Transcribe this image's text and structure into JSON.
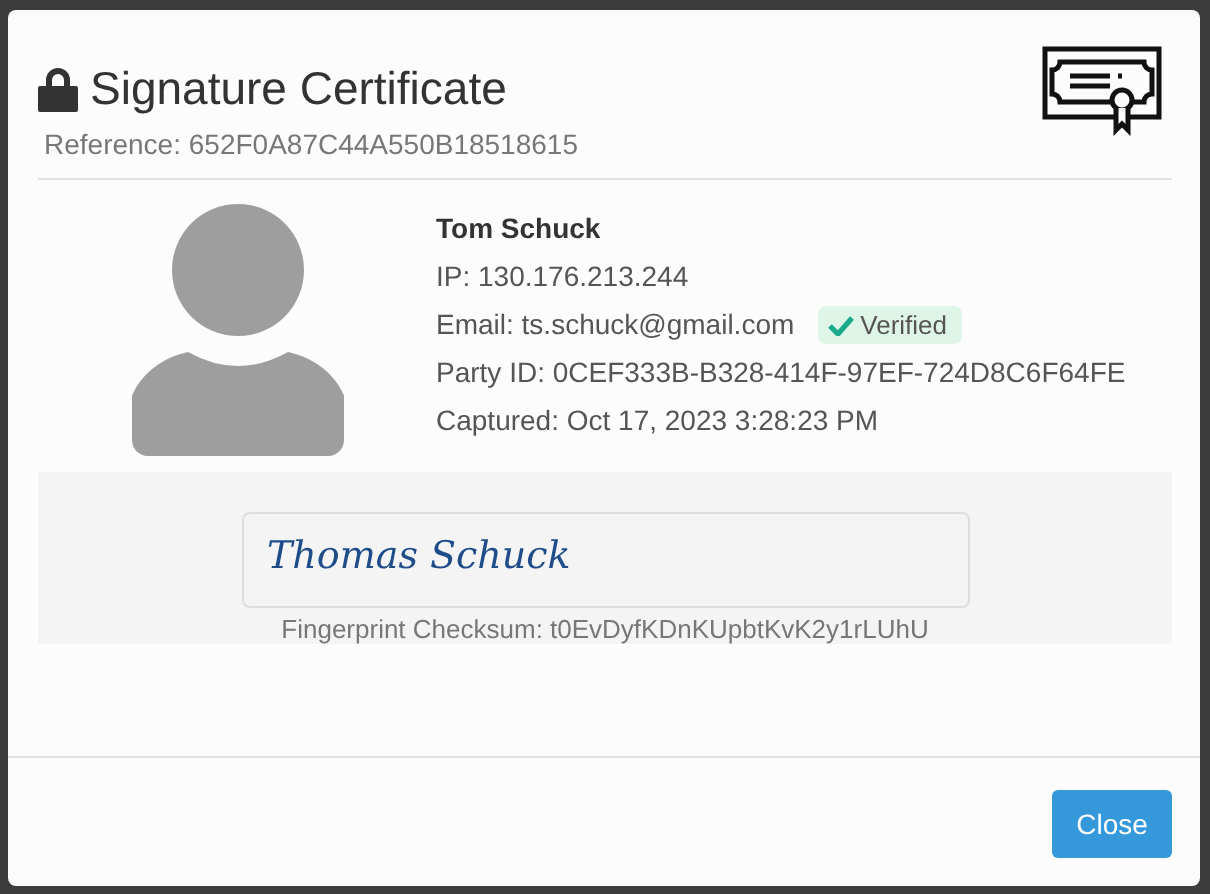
{
  "dialog": {
    "title": "Signature Certificate",
    "reference": "Reference: 652F0A87C44A550B18518615"
  },
  "signer": {
    "name": "Tom Schuck",
    "ip": "IP: 130.176.213.244",
    "email": "Email: ts.schuck@gmail.com",
    "email_badge": {
      "label": "Verified",
      "verified": true
    },
    "party_id": "Party ID: 0CEF333B-B328-414F-97EF-724D8C6F64FE",
    "captured": "Captured: Oct 17, 2023 3:28:23 PM"
  },
  "signature": {
    "name": "Thomas Schuck",
    "checksum": "Fingerprint Checksum: t0EvDyfKDnKUpbtKvK2y1rLUhU"
  },
  "buttons": [
    "Close"
  ]
}
